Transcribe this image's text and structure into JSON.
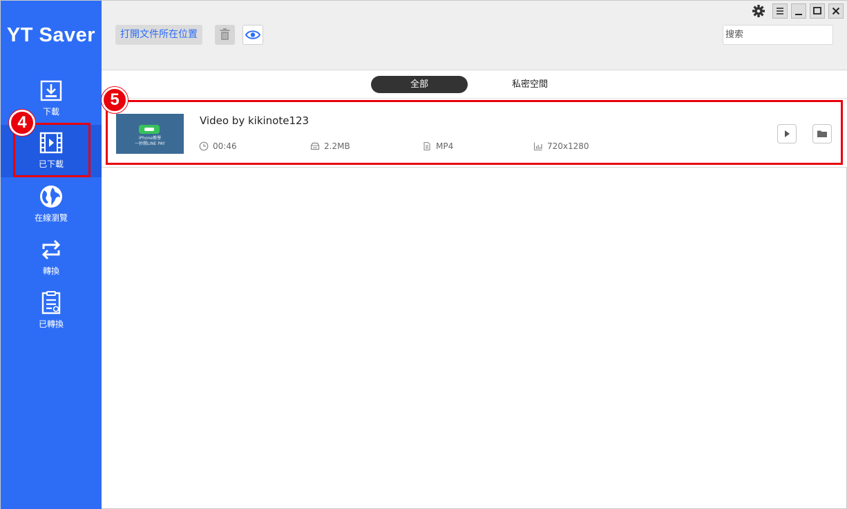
{
  "app": {
    "title": "YT Saver"
  },
  "sidebar": {
    "items": [
      {
        "label": "下載",
        "icon": "download-icon",
        "active": false
      },
      {
        "label": "已下載",
        "icon": "film-icon",
        "active": true
      },
      {
        "label": "在線瀏覽",
        "icon": "globe-icon",
        "active": false
      },
      {
        "label": "轉換",
        "icon": "convert-icon",
        "active": false
      },
      {
        "label": "已轉換",
        "icon": "converted-file-icon",
        "active": false
      }
    ]
  },
  "toolbar": {
    "open_folder_label": "打開文件所在位置",
    "trash_icon": "trash-icon",
    "eye_icon": "eye-icon",
    "search_placeholder": "搜索"
  },
  "window_controls": [
    "gear-icon",
    "menu-icon",
    "minimize-icon",
    "maximize-icon",
    "close-icon"
  ],
  "tabs": [
    {
      "label": "全部",
      "active": true
    },
    {
      "label": "私密空間",
      "active": false
    }
  ],
  "videos": [
    {
      "title": "Video by kikinote123",
      "thumbnail_text": [
        "iPhone教學",
        "一秒開LINE PAY"
      ],
      "duration": "00:46",
      "size": "2.2MB",
      "format": "MP4",
      "resolution": "720x1280"
    }
  ],
  "annotations": [
    {
      "number": "4",
      "target": "sidebar-item-downloaded"
    },
    {
      "number": "5",
      "target": "video-row"
    }
  ],
  "colors": {
    "sidebar": "#2d6df6",
    "sidebar_active": "#1f5ae0",
    "accent": "#2d6df6",
    "callout": "#e8000b",
    "tab_active": "#333333"
  }
}
